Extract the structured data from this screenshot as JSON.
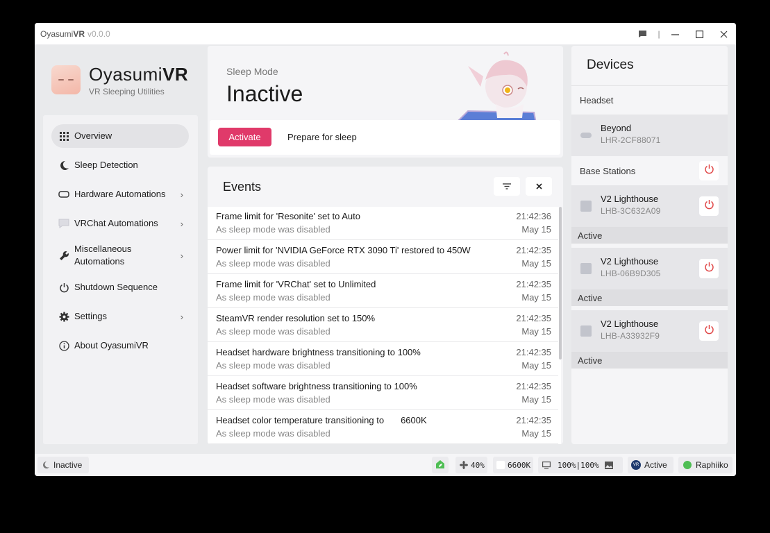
{
  "window": {
    "app_name_light": "Oyasumi",
    "app_name_bold": "VR",
    "version": "v0.0.0"
  },
  "brand": {
    "name_light": "Oyasumi",
    "name_bold": "VR",
    "subtitle": "VR Sleeping Utilities"
  },
  "nav": [
    {
      "label": "Overview",
      "icon": "grid-icon"
    },
    {
      "label": "Sleep Detection",
      "icon": "moon-icon"
    },
    {
      "label": "Hardware Automations",
      "icon": "vr-headset-icon"
    },
    {
      "label": "VRChat Automations",
      "icon": "chat-icon"
    },
    {
      "label": "Miscellaneous Automations",
      "icon": "wrench-icon"
    },
    {
      "label": "Shutdown Sequence",
      "icon": "power-icon"
    },
    {
      "label": "Settings",
      "icon": "gear-icon"
    },
    {
      "label": "About OyasumiVR",
      "icon": "info-icon"
    }
  ],
  "sleep": {
    "label": "Sleep Mode",
    "state": "Inactive",
    "activate_label": "Activate",
    "prepare_label": "Prepare for sleep"
  },
  "events": {
    "title": "Events",
    "items": [
      {
        "title": "Frame limit for 'Resonite' set to Auto",
        "subtitle": "As sleep mode was disabled",
        "time": "21:42:36",
        "date": "May 15"
      },
      {
        "title": "Power limit for 'NVIDIA GeForce RTX 3090 Ti' restored to 450W",
        "subtitle": "As sleep mode was disabled",
        "time": "21:42:35",
        "date": "May 15"
      },
      {
        "title": "Frame limit for 'VRChat' set to Unlimited",
        "subtitle": "As sleep mode was disabled",
        "time": "21:42:35",
        "date": "May 15"
      },
      {
        "title": "SteamVR render resolution set to 150%",
        "subtitle": "As sleep mode was disabled",
        "time": "21:42:35",
        "date": "May 15"
      },
      {
        "title": "Headset hardware brightness transitioning to 100%",
        "subtitle": "As sleep mode was disabled",
        "time": "21:42:35",
        "date": "May 15"
      },
      {
        "title": "Headset software brightness transitioning to 100%",
        "subtitle": "As sleep mode was disabled",
        "time": "21:42:35",
        "date": "May 15"
      },
      {
        "title": "Headset color temperature transitioning to",
        "title_value": "6600K",
        "subtitle": "As sleep mode was disabled",
        "time": "21:42:35",
        "date": "May 15"
      }
    ]
  },
  "devices": {
    "title": "Devices",
    "headset_section": "Headset",
    "headset": {
      "name": "Beyond",
      "serial": "LHR-2CF88071"
    },
    "base_section": "Base Stations",
    "base_stations": [
      {
        "name": "V2 Lighthouse",
        "serial": "LHB-3C632A09",
        "status": "Active"
      },
      {
        "name": "V2 Lighthouse",
        "serial": "LHB-06B9D305",
        "status": "Active"
      },
      {
        "name": "V2 Lighthouse",
        "serial": "LHB-A33932F9",
        "status": "Active"
      }
    ]
  },
  "statusbar": {
    "sleep_state": "Inactive",
    "fan": "40%",
    "color_temp": "6600K",
    "brightness": "100%|100%",
    "vrchat_status": "Active",
    "user": "Raphiiko"
  },
  "colors": {
    "accent": "#e03a6a",
    "power_red": "#e04848",
    "online_green": "#4fbe54"
  }
}
